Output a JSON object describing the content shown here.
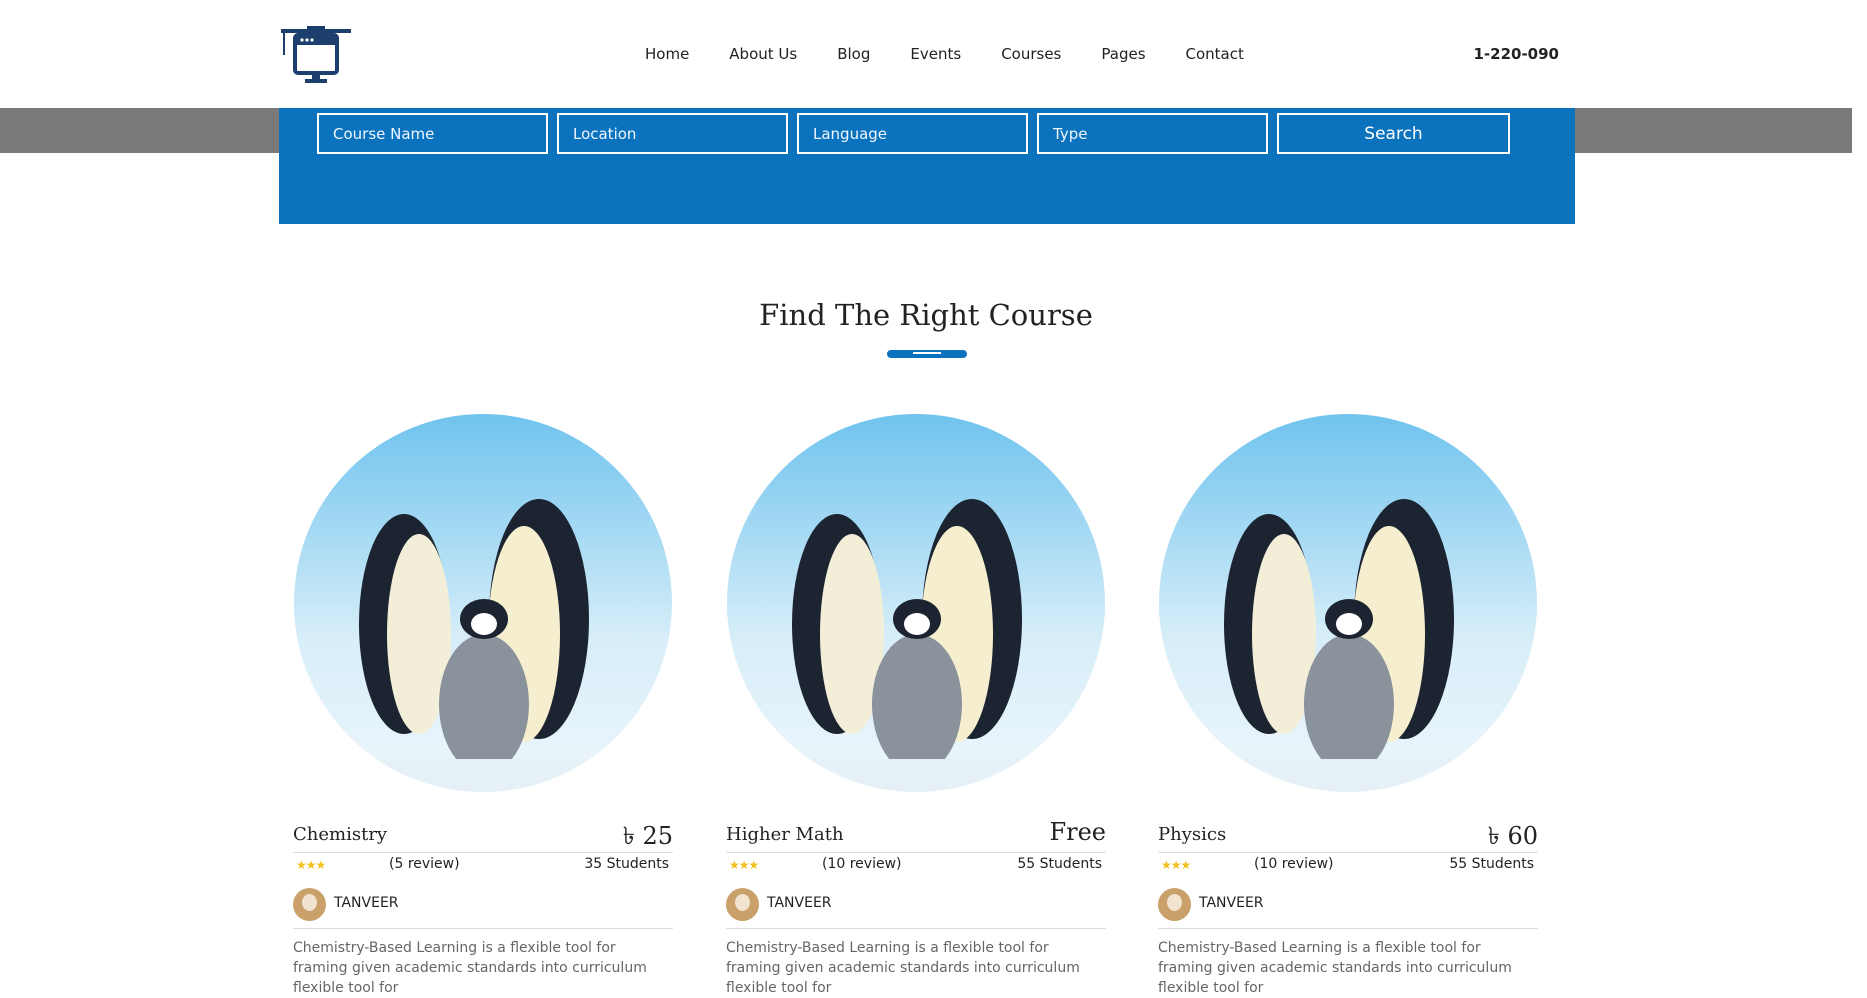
{
  "header": {
    "logo_icon": "graduation-monitor-logo",
    "nav": [
      "Home",
      "About Us",
      "Blog",
      "Events",
      "Courses",
      "Pages",
      "Contact"
    ],
    "phone": "1-220-090"
  },
  "search": {
    "course_placeholder": "Course Name",
    "location_placeholder": "Location",
    "language_placeholder": "Language",
    "type_placeholder": "Type",
    "button": "Search"
  },
  "section": {
    "title": "Find The Right Course"
  },
  "colors": {
    "brand_blue": "#0b73be",
    "star": "#f2c11c"
  },
  "courses": [
    {
      "title": "Chemistry",
      "price": "৳ 25",
      "stars": "★★★",
      "reviews": "(5 review)",
      "students": "35 Students",
      "author": "TANVEER",
      "description": "Chemistry-Based Learning is a flexible tool for framing given academic standards into curriculum flexible tool for"
    },
    {
      "title": "Higher Math",
      "price": "Free",
      "stars": "★★★",
      "reviews": "(10 review)",
      "students": "55 Students",
      "author": "TANVEER",
      "description": "Chemistry-Based Learning is a flexible tool for framing given academic standards into curriculum flexible tool for"
    },
    {
      "title": "Physics",
      "price": "৳ 60",
      "stars": "★★★",
      "reviews": "(10 review)",
      "students": "55 Students",
      "author": "TANVEER",
      "description": "Chemistry-Based Learning is a flexible tool for framing given academic standards into curriculum flexible tool for"
    }
  ]
}
